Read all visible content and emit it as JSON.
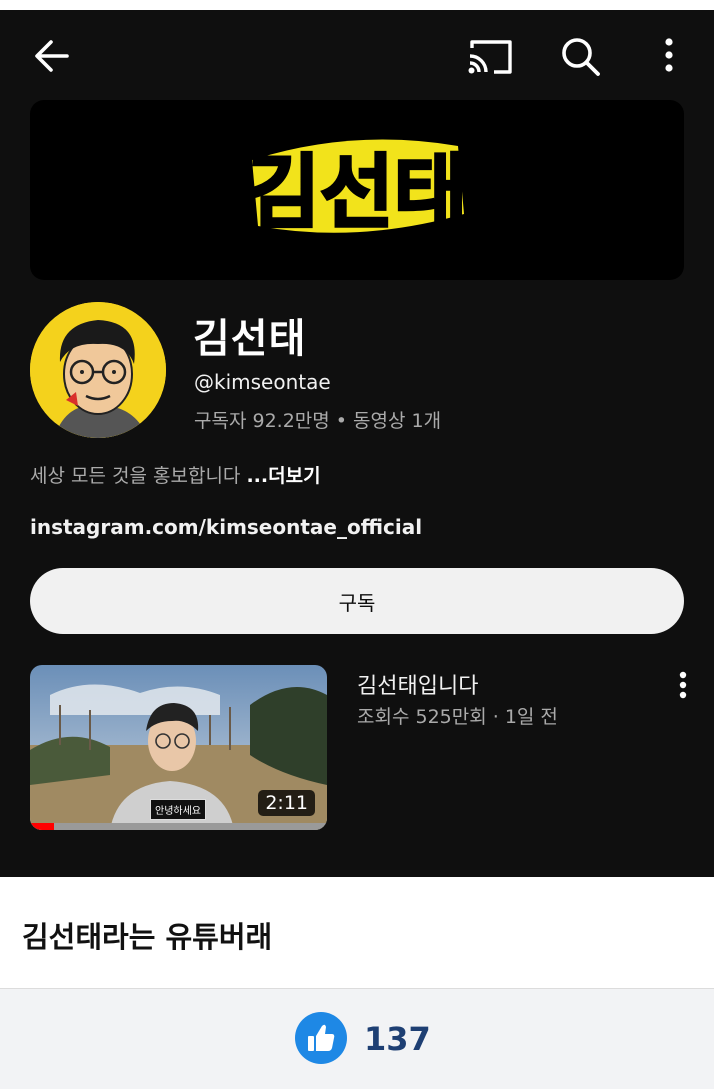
{
  "topbar": {
    "back_icon": "arrow-left-icon",
    "cast_icon": "cast-icon",
    "search_icon": "search-icon",
    "more_icon": "more-vertical-icon"
  },
  "banner": {
    "logo_text": "김선태",
    "logo_color": "#f2e31b"
  },
  "channel": {
    "name": "김선태",
    "handle": "@kimseontae",
    "stats": "구독자 92.2만명 • 동영상 1개",
    "description": "세상 모든 것을 홍보합니다",
    "more_label": "...더보기",
    "link": "instagram.com/kimseontae_official",
    "subscribe_label": "구독"
  },
  "video": {
    "title": "김선태입니다",
    "meta": "조회수 525만회 · 1일 전",
    "duration": "2:11",
    "caption": "안녕하세요",
    "progress": 0.08
  },
  "post": {
    "title": "김선태라는 유튜버래"
  },
  "reaction": {
    "like_icon": "thumbs-up-icon",
    "count": "137",
    "color": "#1e88e5"
  }
}
